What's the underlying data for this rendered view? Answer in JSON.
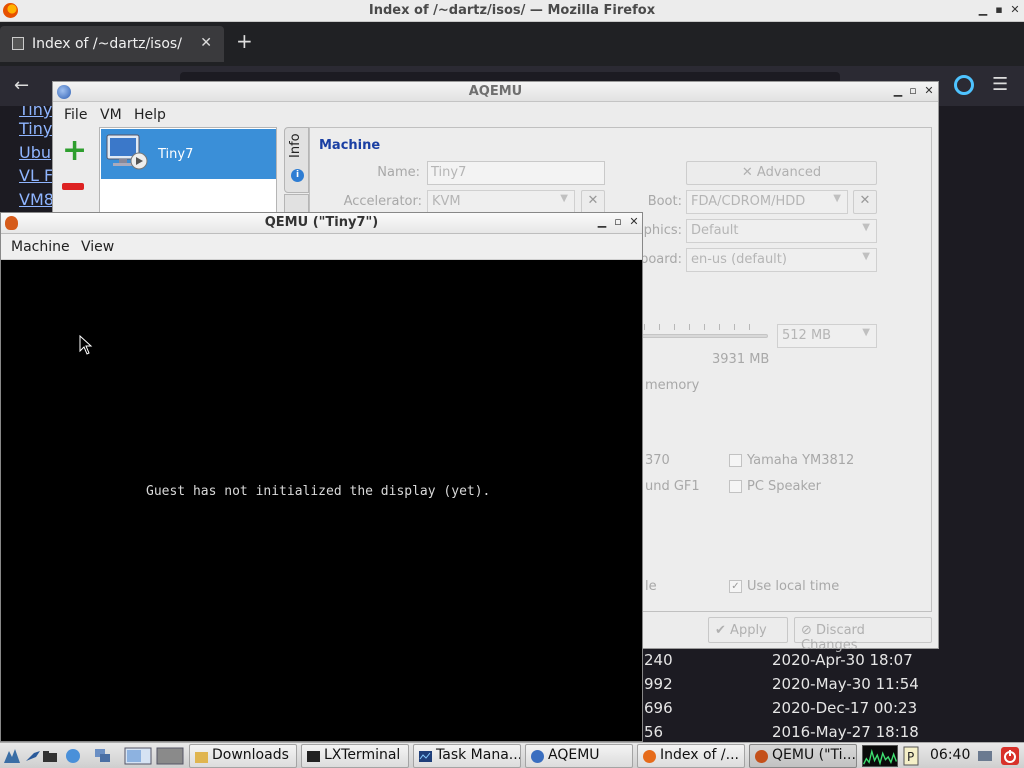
{
  "firefox": {
    "window_title": "Index of /~dartz/isos/ — Mozilla Firefox",
    "tab_label": "Index of /~dartz/isos/",
    "listing_links": [
      "Tiny",
      "Ubu",
      "VL F",
      "VM8"
    ],
    "listing_sizes": [
      "240",
      "992",
      "696",
      "56"
    ],
    "listing_dates": [
      "2020-Apr-30 18:07",
      "2020-May-30 11:54",
      "2020-Dec-17 00:23",
      "2016-May-27 18:18"
    ]
  },
  "aqemu": {
    "title": "AQEMU",
    "menu": [
      "File",
      "VM",
      "Help"
    ],
    "vm_name": "Tiny7",
    "tab_info": "Info",
    "section_title": "Machine",
    "name_label": "Name:",
    "name_value": "Tiny7",
    "accelerator_label": "Accelerator:",
    "accelerator_value": "KVM",
    "advanced_label": "Advanced",
    "boot_label": "Boot:",
    "boot_value": "FDA/CDROM/HDD",
    "graphics_label": "phics:",
    "graphics_value": "Default",
    "keyboard_label": "board:",
    "keyboard_value": "en-us (default)",
    "memory_value": "512 MB",
    "memory_total": "3931 MB",
    "memory_label": "memory",
    "audio_left_1": "370",
    "audio_left_2": "und GF1",
    "audio_yamaha": "Yamaha YM3812",
    "audio_pcspeaker": "PC Speaker",
    "misc_left": "le",
    "use_local_time": "Use local time",
    "apply": "Apply",
    "discard": "Discard Changes"
  },
  "qemu": {
    "title": "QEMU (\"Tiny7\")",
    "menu": [
      "Machine",
      "View"
    ],
    "guest_message": "Guest has not initialized the display (yet)."
  },
  "taskbar": {
    "tasks": [
      "Downloads",
      "LXTerminal",
      "Task Mana...",
      "AQEMU",
      "Index of /...",
      "QEMU (\"Ti..."
    ],
    "clock": "06:40"
  }
}
